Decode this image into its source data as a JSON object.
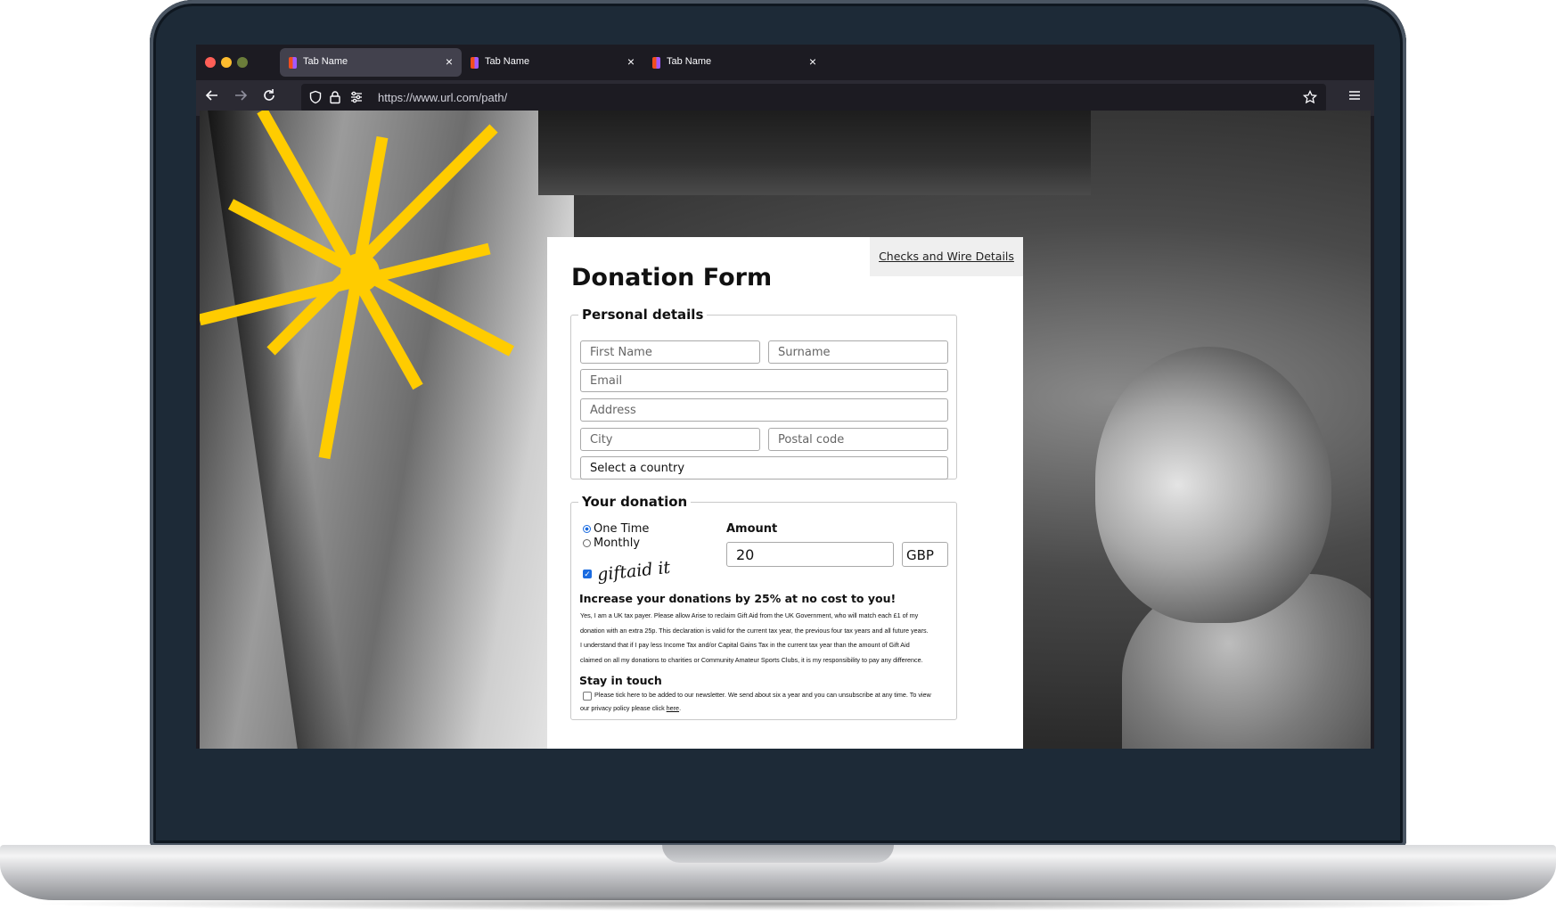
{
  "browser": {
    "tabs": [
      {
        "label": "Tab Name",
        "active": true
      },
      {
        "label": "Tab Name",
        "active": false
      },
      {
        "label": "Tab Name",
        "active": false
      }
    ],
    "close_glyph": "×",
    "url": "https://www.url.com/path/",
    "icons": {
      "back": "arrow-left-icon",
      "forward": "arrow-right-icon",
      "reload": "reload-icon",
      "shield": "shield-icon",
      "lock": "lock-icon",
      "permissions": "sliders-icon",
      "bookmark": "star-icon",
      "menu": "hamburger-menu-icon"
    },
    "window_dots": [
      "#ff5f57",
      "#febc2e",
      "#6b7d3a"
    ]
  },
  "form": {
    "checks_link": "Checks and Wire Details",
    "title": "Donation Form",
    "personal": {
      "legend": "Personal details",
      "first_name": "First Name",
      "surname": "Surname",
      "email": "Email",
      "address": "Address",
      "city": "City",
      "postal_code": "Postal code",
      "country": "Select a country"
    },
    "donation": {
      "legend": "Your donation",
      "one_time": "One Time",
      "monthly": "Monthly",
      "amount_label": "Amount",
      "amount_value": "20",
      "currency": "GBP",
      "giftaid_logo": "giftaid it",
      "giftaid_checked": true,
      "increase_heading": "Increase your donations by 25% at no cost to you!",
      "declaration_lines": [
        "Yes, I am a UK tax payer. Please allow Arise to reclaim Gift Aid from the UK Government, who will match each £1 of my",
        "donation with an extra 25p. This declaration is valid for the current tax year, the previous four tax years and all future years.",
        "I understand that if I pay less Income Tax and/or Capital Gains Tax in the current tax year than the amount of Gift Aid",
        "claimed on all my donations to charities or Community Amateur Sports Clubs, it is my responsibility to pay any difference."
      ],
      "stay_heading": "Stay in touch",
      "newsletter_line1": "Please tick here to be added to our newsletter. We send about six a year and you can unsubscribe at any time. To view",
      "newsletter_line2_prefix": "our privacy policy please click ",
      "newsletter_link": "here",
      "newsletter_line2_suffix": "."
    }
  },
  "colors": {
    "accent_star": "#ffcc00",
    "radio_checked": "#1a6be0",
    "frame": "#1d2a37"
  }
}
